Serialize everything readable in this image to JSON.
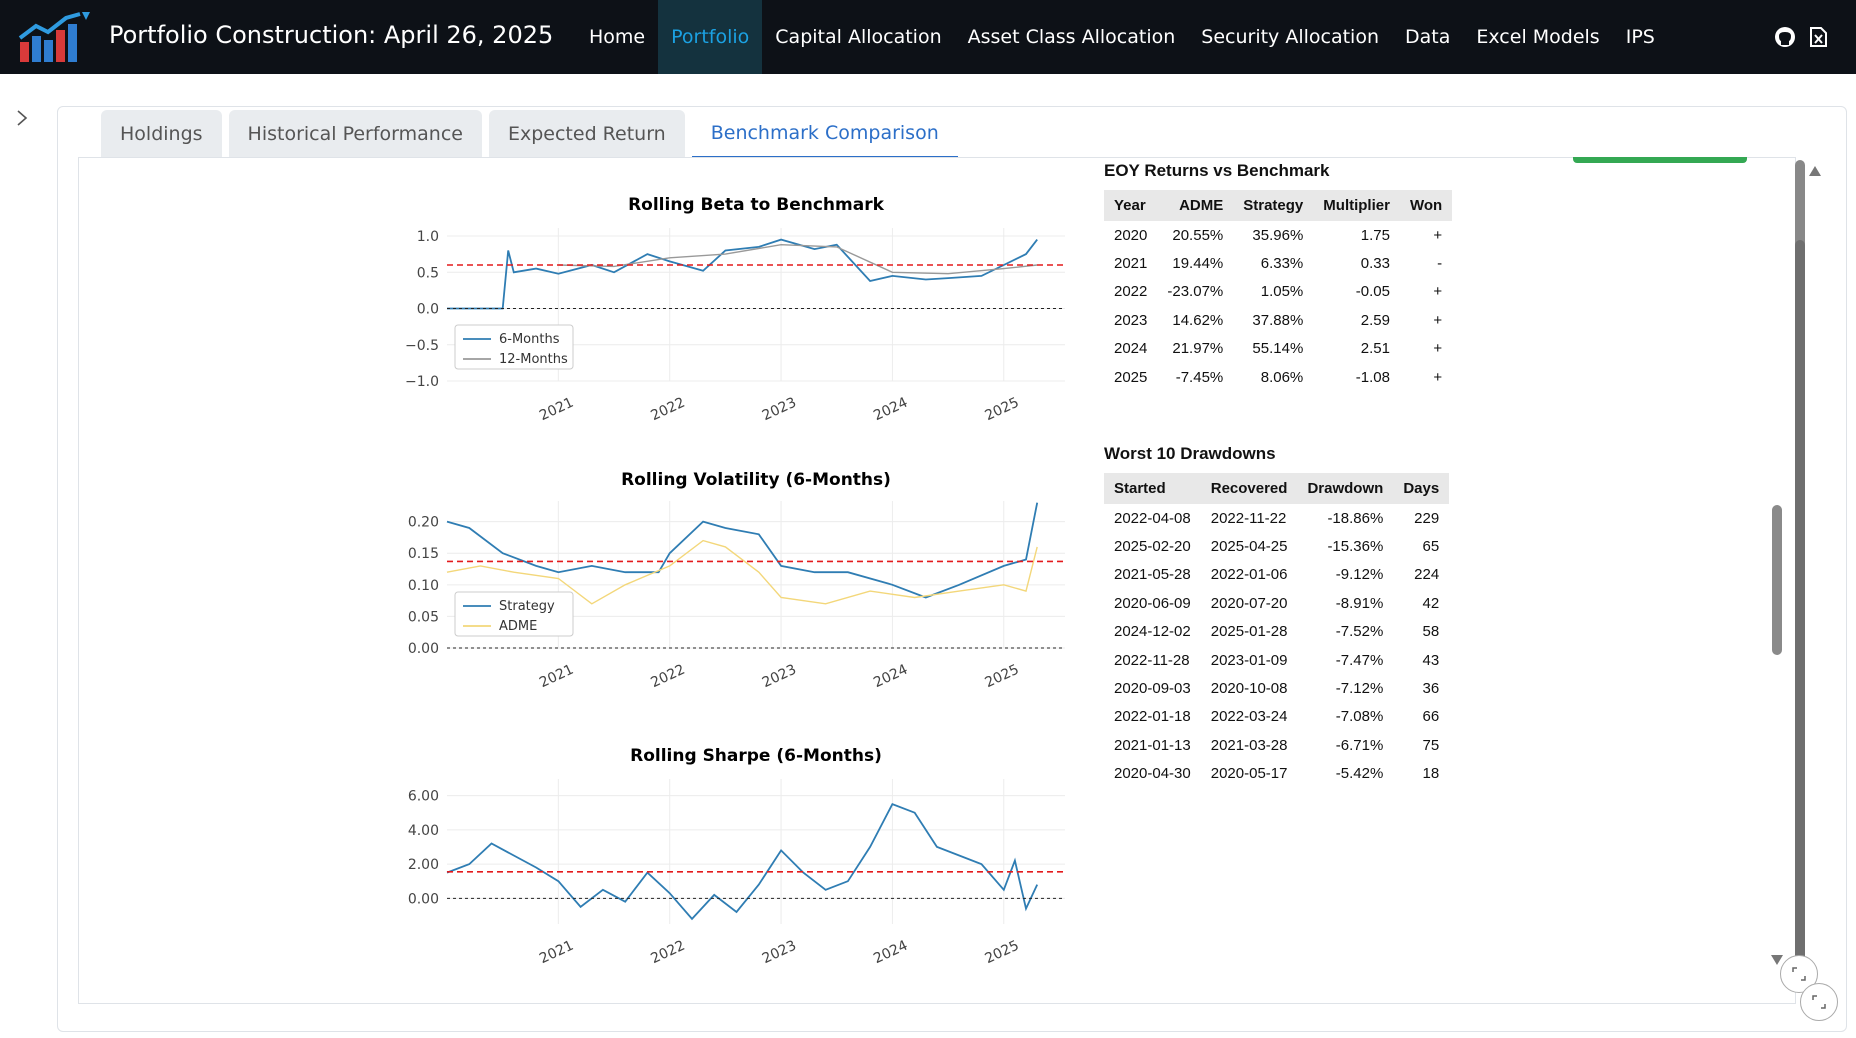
{
  "app": {
    "title": "Portfolio Construction: April 26, 2025",
    "nav": [
      "Home",
      "Portfolio",
      "Capital Allocation",
      "Asset Class Allocation",
      "Security Allocation",
      "Data",
      "Excel Models",
      "IPS"
    ],
    "active_nav": "Portfolio",
    "icons": [
      "logo-chart-icon",
      "github-icon",
      "excel-icon",
      "chevron-right-icon",
      "fullscreen-icon"
    ]
  },
  "tabs": {
    "items": [
      "Holdings",
      "Historical Performance",
      "Expected Return",
      "Benchmark Comparison"
    ],
    "active": "Benchmark Comparison"
  },
  "colors": {
    "strategy": "#2f7db3",
    "benchmark_12m": "#999999",
    "adme": "#f3d77a",
    "reference": "#e31a1c",
    "accent": "#2c6fc8",
    "nav_bg": "#0d1117"
  },
  "charts": [
    {
      "title": "Rolling Beta to Benchmark",
      "y_ticks": [
        "1.0",
        "0.5",
        "0.0",
        "−0.5",
        "−1.0"
      ],
      "x_ticks": [
        "2021",
        "2022",
        "2023",
        "2024",
        "2025"
      ],
      "legend": [
        "6-Months",
        "12-Months"
      ]
    },
    {
      "title": "Rolling Volatility (6-Months)",
      "y_ticks": [
        "0.20",
        "0.15",
        "0.10",
        "0.05",
        "0.00"
      ],
      "x_ticks": [
        "2021",
        "2022",
        "2023",
        "2024",
        "2025"
      ],
      "legend": [
        "Strategy",
        "ADME"
      ]
    },
    {
      "title": "Rolling Sharpe (6-Months)",
      "y_ticks": [
        "6.00",
        "4.00",
        "2.00",
        "0.00"
      ],
      "x_ticks": [
        "2021",
        "2022",
        "2023",
        "2024",
        "2025"
      ],
      "legend": []
    }
  ],
  "chart_data": [
    {
      "type": "line",
      "title": "Rolling Beta to Benchmark",
      "x_range": [
        "2020-01",
        "2025-04"
      ],
      "ylim": [
        -1.0,
        1.0
      ],
      "grid": true,
      "legend_position": "lower-left",
      "reference_lines": [
        {
          "y": 0.6,
          "style": "dashed",
          "color": "red"
        },
        {
          "y": 0.0,
          "style": "dashed",
          "color": "black"
        }
      ],
      "series": [
        {
          "name": "6-Months",
          "x": [
            2020.0,
            2020.5,
            2020.55,
            2020.6,
            2020.8,
            2021.0,
            2021.3,
            2021.5,
            2021.8,
            2022.0,
            2022.3,
            2022.5,
            2022.8,
            2023.0,
            2023.3,
            2023.5,
            2023.8,
            2024.0,
            2024.3,
            2024.5,
            2024.8,
            2025.0,
            2025.2,
            2025.3
          ],
          "y": [
            0.0,
            0.0,
            0.8,
            0.5,
            0.55,
            0.48,
            0.6,
            0.5,
            0.75,
            0.65,
            0.52,
            0.8,
            0.85,
            0.95,
            0.82,
            0.88,
            0.38,
            0.45,
            0.4,
            0.42,
            0.45,
            0.6,
            0.75,
            0.95
          ]
        },
        {
          "name": "12-Months",
          "x": [
            2021.0,
            2021.5,
            2022.0,
            2022.5,
            2023.0,
            2023.5,
            2024.0,
            2024.5,
            2025.0,
            2025.3
          ],
          "y": [
            0.6,
            0.58,
            0.7,
            0.75,
            0.88,
            0.85,
            0.5,
            0.48,
            0.55,
            0.6
          ]
        }
      ]
    },
    {
      "type": "line",
      "title": "Rolling Volatility (6-Months)",
      "x_range": [
        "2020-01",
        "2025-04"
      ],
      "ylim": [
        0.0,
        0.22
      ],
      "grid": true,
      "legend_position": "lower-left",
      "reference_lines": [
        {
          "y": 0.137,
          "style": "dashed",
          "color": "red"
        },
        {
          "y": 0.0,
          "style": "dashed",
          "color": "black"
        }
      ],
      "series": [
        {
          "name": "Strategy",
          "x": [
            2020.0,
            2020.2,
            2020.5,
            2020.8,
            2021.0,
            2021.3,
            2021.6,
            2021.9,
            2022.0,
            2022.3,
            2022.5,
            2022.8,
            2023.0,
            2023.3,
            2023.6,
            2024.0,
            2024.3,
            2024.6,
            2025.0,
            2025.2,
            2025.3
          ],
          "y": [
            0.2,
            0.19,
            0.15,
            0.13,
            0.12,
            0.13,
            0.12,
            0.12,
            0.15,
            0.2,
            0.19,
            0.18,
            0.13,
            0.12,
            0.12,
            0.1,
            0.08,
            0.1,
            0.13,
            0.14,
            0.23
          ]
        },
        {
          "name": "ADME",
          "x": [
            2020.0,
            2020.3,
            2020.6,
            2021.0,
            2021.3,
            2021.6,
            2022.0,
            2022.3,
            2022.5,
            2022.8,
            2023.0,
            2023.4,
            2023.8,
            2024.2,
            2024.6,
            2025.0,
            2025.2,
            2025.3
          ],
          "y": [
            0.12,
            0.13,
            0.12,
            0.11,
            0.07,
            0.1,
            0.13,
            0.17,
            0.16,
            0.12,
            0.08,
            0.07,
            0.09,
            0.08,
            0.09,
            0.1,
            0.09,
            0.16
          ]
        }
      ]
    },
    {
      "type": "line",
      "title": "Rolling Sharpe (6-Months)",
      "x_range": [
        "2020-01",
        "2025-04"
      ],
      "ylim": [
        -1.5,
        6.5
      ],
      "grid": true,
      "reference_lines": [
        {
          "y": 1.55,
          "style": "dashed",
          "color": "red"
        },
        {
          "y": 0.0,
          "style": "dashed",
          "color": "black"
        }
      ],
      "series": [
        {
          "name": "",
          "x": [
            2020.0,
            2020.2,
            2020.4,
            2020.6,
            2020.8,
            2021.0,
            2021.2,
            2021.4,
            2021.6,
            2021.8,
            2022.0,
            2022.2,
            2022.4,
            2022.6,
            2022.8,
            2023.0,
            2023.2,
            2023.4,
            2023.6,
            2023.8,
            2024.0,
            2024.2,
            2024.4,
            2024.6,
            2024.8,
            2025.0,
            2025.1,
            2025.2,
            2025.3
          ],
          "y": [
            1.5,
            2.0,
            3.2,
            2.5,
            1.8,
            1.0,
            -0.5,
            0.5,
            -0.2,
            1.5,
            0.3,
            -1.2,
            0.2,
            -0.8,
            0.8,
            2.8,
            1.5,
            0.5,
            1.0,
            3.0,
            5.5,
            5.0,
            3.0,
            2.5,
            2.0,
            0.5,
            2.2,
            -0.6,
            0.8
          ]
        }
      ]
    },
    {
      "type": "table",
      "title": "EOY Returns vs Benchmark",
      "columns": [
        "Year",
        "ADME",
        "Strategy",
        "Multiplier",
        "Won"
      ],
      "rows": [
        [
          "2020",
          "20.55%",
          "35.96%",
          "1.75",
          "+"
        ],
        [
          "2021",
          "19.44%",
          "6.33%",
          "0.33",
          "-"
        ],
        [
          "2022",
          "-23.07%",
          "1.05%",
          "-0.05",
          "+"
        ],
        [
          "2023",
          "14.62%",
          "37.88%",
          "2.59",
          "+"
        ],
        [
          "2024",
          "21.97%",
          "55.14%",
          "2.51",
          "+"
        ],
        [
          "2025",
          "-7.45%",
          "8.06%",
          "-1.08",
          "+"
        ]
      ]
    },
    {
      "type": "table",
      "title": "Worst 10 Drawdowns",
      "columns": [
        "Started",
        "Recovered",
        "Drawdown",
        "Days"
      ],
      "rows": [
        [
          "2022-04-08",
          "2022-11-22",
          "-18.86%",
          "229"
        ],
        [
          "2025-02-20",
          "2025-04-25",
          "-15.36%",
          "65"
        ],
        [
          "2021-05-28",
          "2022-01-06",
          "-9.12%",
          "224"
        ],
        [
          "2020-06-09",
          "2020-07-20",
          "-8.91%",
          "42"
        ],
        [
          "2024-12-02",
          "2025-01-28",
          "-7.52%",
          "58"
        ],
        [
          "2022-11-28",
          "2023-01-09",
          "-7.47%",
          "43"
        ],
        [
          "2020-09-03",
          "2020-10-08",
          "-7.12%",
          "36"
        ],
        [
          "2022-01-18",
          "2022-03-24",
          "-7.08%",
          "66"
        ],
        [
          "2021-01-13",
          "2021-03-28",
          "-6.71%",
          "75"
        ],
        [
          "2020-04-30",
          "2020-05-17",
          "-5.42%",
          "18"
        ]
      ]
    }
  ]
}
